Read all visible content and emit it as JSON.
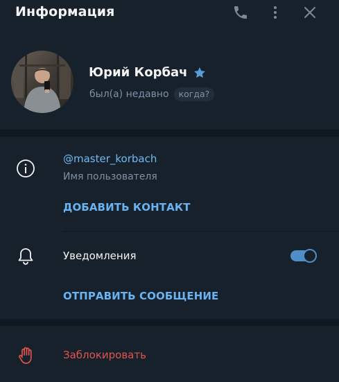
{
  "header": {
    "title": "Информация",
    "icons": [
      "phone-icon",
      "more-vertical-icon",
      "close-icon"
    ]
  },
  "profile": {
    "name": "Юрий Корбач",
    "status": "был(а) недавно",
    "when_label": "когда?",
    "badge_icon": "star-icon",
    "avatar_icon": "avatar-photo"
  },
  "info": {
    "username": "@master_korbach",
    "username_caption": "Имя пользователя",
    "add_contact_label": "ДОБАВИТЬ КОНТАКТ"
  },
  "notifications": {
    "label": "Уведомления",
    "enabled": true
  },
  "actions": {
    "send_message_label": "ОТПРАВИТЬ СООБЩЕНИЕ",
    "block_label": "Заблокировать"
  },
  "colors": {
    "background": "#17212b",
    "separator": "#101921",
    "accent": "#6ab3f3",
    "danger": "#e1544d",
    "muted": "#7f91a4",
    "star": "#5b9bd5"
  }
}
